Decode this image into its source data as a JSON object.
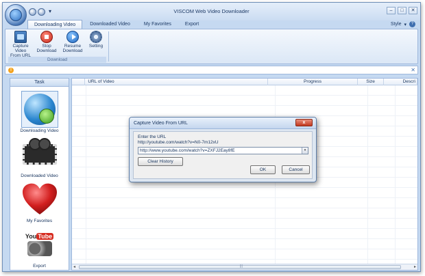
{
  "window": {
    "title": "VISCOM Web Video Downloader"
  },
  "qat": {
    "dropdown_glyph": "▾"
  },
  "window_controls": {
    "minimize": "–",
    "maximize": "□",
    "close": "✕"
  },
  "tabs": [
    {
      "label": "Downloading Video",
      "active": true
    },
    {
      "label": "Downloaded Video",
      "active": false
    },
    {
      "label": "My Favorites",
      "active": false
    },
    {
      "label": "Export",
      "active": false
    }
  ],
  "style_menu": {
    "label": "Style",
    "arrow": "▾",
    "help": "?"
  },
  "ribbon": {
    "group_label": "Download",
    "buttons": [
      {
        "line1": "Capture Video",
        "line2": "From URL",
        "icon": "capture-video-icon"
      },
      {
        "line1": "Stop",
        "line2": "Download",
        "icon": "stop-icon"
      },
      {
        "line1": "Resume",
        "line2": "Download",
        "icon": "resume-icon"
      },
      {
        "line1": "Setting",
        "line2": "",
        "icon": "gear-icon"
      }
    ]
  },
  "infobar": {
    "icon_glyph": "!",
    "close_glyph": "✕"
  },
  "sidebar": {
    "header": "Task",
    "items": [
      {
        "label": "Downloading Video",
        "icon": "globe-download-icon"
      },
      {
        "label": "Downloaded Video",
        "icon": "film-reel-icon"
      },
      {
        "label": "My Favorites",
        "icon": "heart-icon"
      },
      {
        "label": "Export",
        "icon": "youtube-export-icon"
      }
    ],
    "export_logo": {
      "you": "You",
      "tube": "Tube"
    }
  },
  "grid": {
    "columns": [
      "",
      "URL of Video",
      "Progress",
      "Size",
      "Descri"
    ],
    "scroll_left": "◂",
    "scroll_right": "▸"
  },
  "dialog": {
    "title": "Capture Video From URL",
    "close_glyph": "x",
    "prompt": "Enter the URL",
    "example": "http://youtube.com/watch?v=N0-7m12xU",
    "url_value": "http://www.youtube.com/watch?v=ZXFJ2Eay8fE",
    "combo_arrow": "▾",
    "clear_history": "Clear History",
    "ok": "OK",
    "cancel": "Cancel"
  },
  "colors": {
    "ribbon_bg": "#c5d9f1",
    "accent": "#3f6fb0",
    "dialog_close": "#c2381f",
    "heart": "#d21f1f"
  }
}
